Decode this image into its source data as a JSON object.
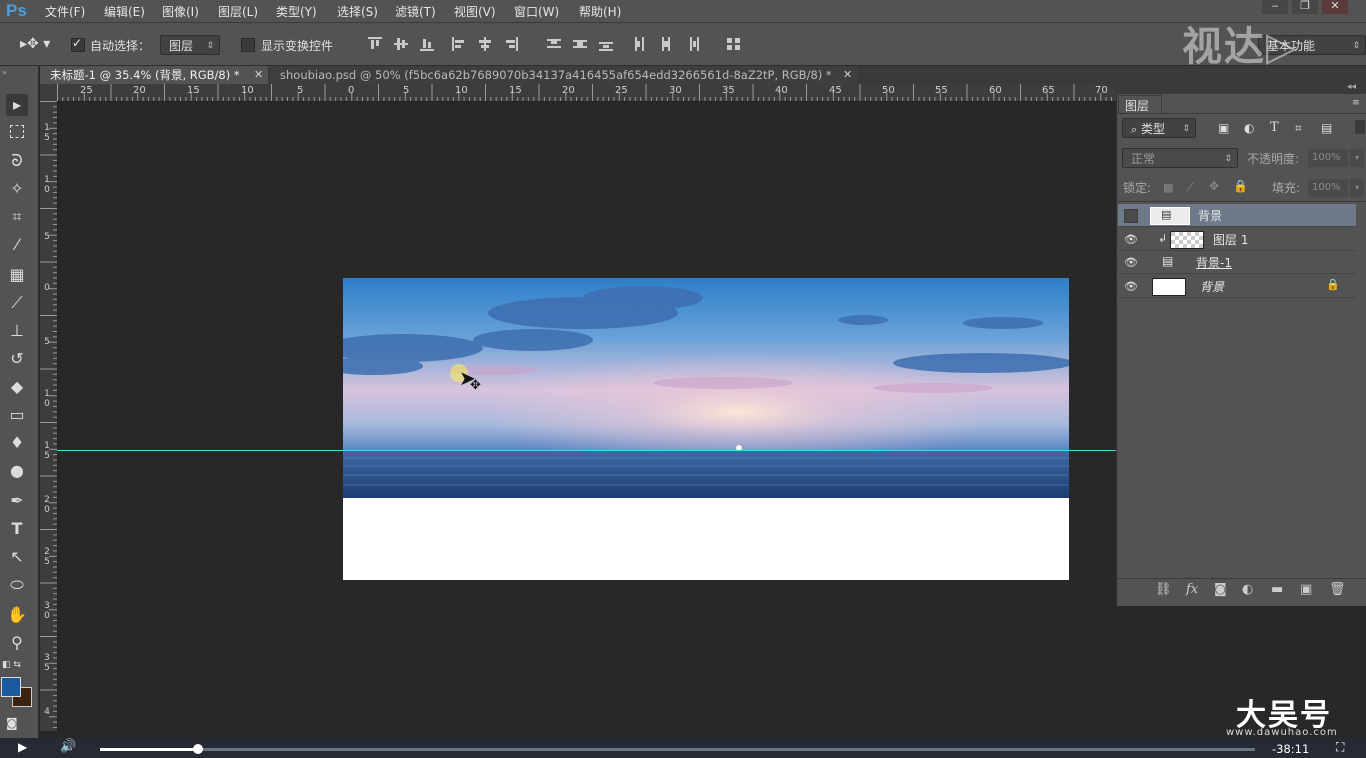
{
  "app": {
    "logo": "Ps",
    "menu": [
      "文件(F)",
      "编辑(E)",
      "图像(I)",
      "图层(L)",
      "类型(Y)",
      "选择(S)",
      "滤镜(T)",
      "视图(V)",
      "窗口(W)",
      "帮助(H)"
    ],
    "window_buttons": {
      "minimize": "‒",
      "restore": "❐",
      "close": "✕"
    }
  },
  "watermarks": {
    "top": "视达▷",
    "bottom": "大吴号",
    "bottom_url": "www.dawuhao.com"
  },
  "options_bar": {
    "auto_select_label": "自动选择：",
    "auto_select_checked": true,
    "auto_select_target": "图层",
    "show_transform_label": "显示变换控件",
    "show_transform_checked": false,
    "workspace": "基本功能"
  },
  "tabs": [
    {
      "label": "未标题-1 @ 35.4% (背景, RGB/8) *",
      "active": true
    },
    {
      "label": "shoubiao.psd @ 50% (f5bc6a62b7689070b34137a416455af654edd3266561d-8aZ2tP, RGB/8) *",
      "active": false
    }
  ],
  "ruler": {
    "h_labels": [
      "25",
      "20",
      "15",
      "10",
      "5",
      "0",
      "5",
      "10",
      "15",
      "20",
      "25",
      "30",
      "35",
      "40",
      "45",
      "50",
      "55",
      "60",
      "65",
      "70"
    ],
    "v_labels": [
      "1\n5",
      "1\n0",
      "5",
      "0",
      "5",
      "1\n0",
      "1\n5",
      "2\n0",
      "2\n5",
      "3\n0",
      "3\n5",
      "4"
    ]
  },
  "layers_panel": {
    "title": "图层",
    "filter_kind": "类型",
    "blend_mode": "正常",
    "opacity_label": "不透明度:",
    "opacity_value": "100%",
    "lock_label": "锁定:",
    "fill_label": "填充:",
    "fill_value": "100%",
    "layers": [
      {
        "name": "背景",
        "visible": false,
        "selected": true,
        "kind": "smart"
      },
      {
        "name": "图层 1",
        "visible": true,
        "selected": false,
        "kind": "transparent",
        "clipped": true
      },
      {
        "name": "背景-1",
        "visible": true,
        "selected": false,
        "kind": "smart"
      },
      {
        "name": "背景",
        "visible": true,
        "selected": false,
        "kind": "white",
        "locked": true
      }
    ]
  },
  "video": {
    "time": "-38:11",
    "progress": 0.085
  },
  "colors": {
    "foreground": "#1a5aa0",
    "background": "#3a2410",
    "guide": "#4dd8e0"
  }
}
